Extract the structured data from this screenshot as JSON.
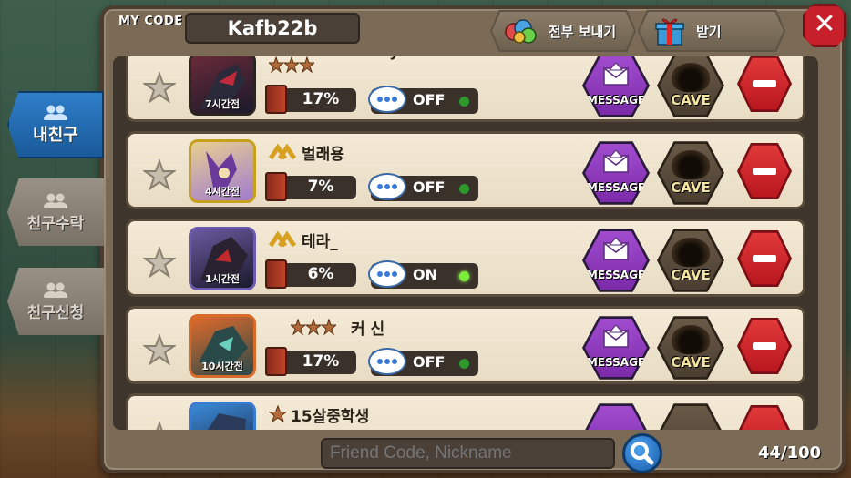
{
  "header": {
    "my_code_label": "MY CODE",
    "my_code_value": "Kafb22b",
    "send_all_label": "전부 보내기",
    "receive_label": "받기",
    "close_label": "✕"
  },
  "side_tabs": [
    {
      "label": "내친구",
      "active": true
    },
    {
      "label": "친구수락",
      "active": false
    },
    {
      "label": "친구신청",
      "active": false
    }
  ],
  "friends": [
    {
      "name": "lovely",
      "rank": "bronze-stars",
      "time": "7시간전",
      "percent": "17%",
      "status": "OFF",
      "online": false
    },
    {
      "name": "벌래용",
      "rank": "gold-chevron",
      "time": "4시간전",
      "percent": "7%",
      "status": "OFF",
      "online": false
    },
    {
      "name": "테라_",
      "rank": "gold-chevron",
      "time": "1시간전",
      "percent": "6%",
      "status": "ON",
      "online": true
    },
    {
      "name": "커 신",
      "rank": "bronze-stars",
      "time": "10시간전",
      "percent": "17%",
      "status": "OFF",
      "online": false
    },
    {
      "name": "15살중학생",
      "rank": "single-star",
      "time": "",
      "percent": "",
      "status": "",
      "online": false
    }
  ],
  "row_buttons": {
    "message": "MESSAGE",
    "cave": "CAVE"
  },
  "search": {
    "placeholder": "Friend Code, Nickname"
  },
  "friend_count": "44/100",
  "colors": {
    "active_tab": "#2e7ec8",
    "message": "#a24cd0",
    "delete": "#e23a3a",
    "online_dot": "#7aee3a"
  }
}
